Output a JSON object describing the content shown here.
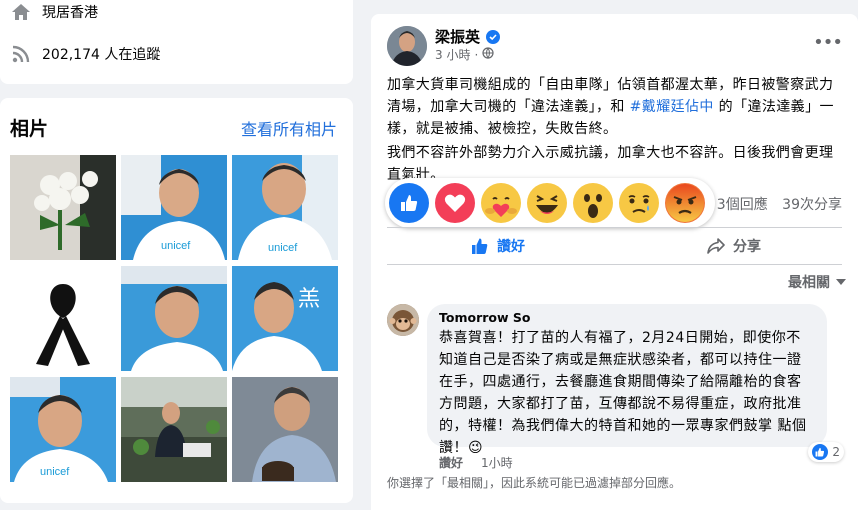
{
  "sidebar": {
    "location_text": "現居香港",
    "followers_text": "202,174 人在追蹤",
    "photos_title": "相片",
    "photos_link": "查看所有相片"
  },
  "post": {
    "author": "梁振英",
    "time": "3 小時",
    "paragraph1_before": "加拿大貨車司機組成的「自由車隊」佔領首都渥太華，昨日被警察武力清場，加拿大司機的「違法達義」，和",
    "hashtag": "#戴耀廷佔中",
    "paragraph1_after": "的「違法達義」一樣，就是被捕、被檢控，失敗告終。",
    "paragraph2": "我們不容許外部勢力介入示威抗議，加拿大也不容許。日後我們會更理直氣壯。",
    "reactions": [
      "like",
      "love",
      "care",
      "haha",
      "wow",
      "sad",
      "angry"
    ],
    "comments_count": "3個回應",
    "shares_count": "39次分享",
    "like_label": "讚好",
    "share_label": "分享",
    "sort_label": "最相關"
  },
  "comment": {
    "author": "Tomorrow So",
    "text": "恭喜賀喜！打了苗的人有福了，2月24日開始，即使你不知道自己是否染了病或是無症狀感染者，都可以持住一證在手，四處通行，去餐廳進食期間傳染了給隔離枱的食客方問題，大家都打了苗，互傳都說不易得重症，政府批准的，特權！為我們偉大的特首和她的一眾專家們鼓掌 點個讚！😉",
    "like_label": "讚好",
    "time": "1小時",
    "like_count": "2"
  },
  "filter_note": "你選擇了「最相關」，因此系統可能已過濾掉部分回應。",
  "colors": {
    "link": "#216fdb",
    "like_blue": "#1877f2",
    "love_red": "#f33e58",
    "emoji_yellow": "#f7c844"
  }
}
